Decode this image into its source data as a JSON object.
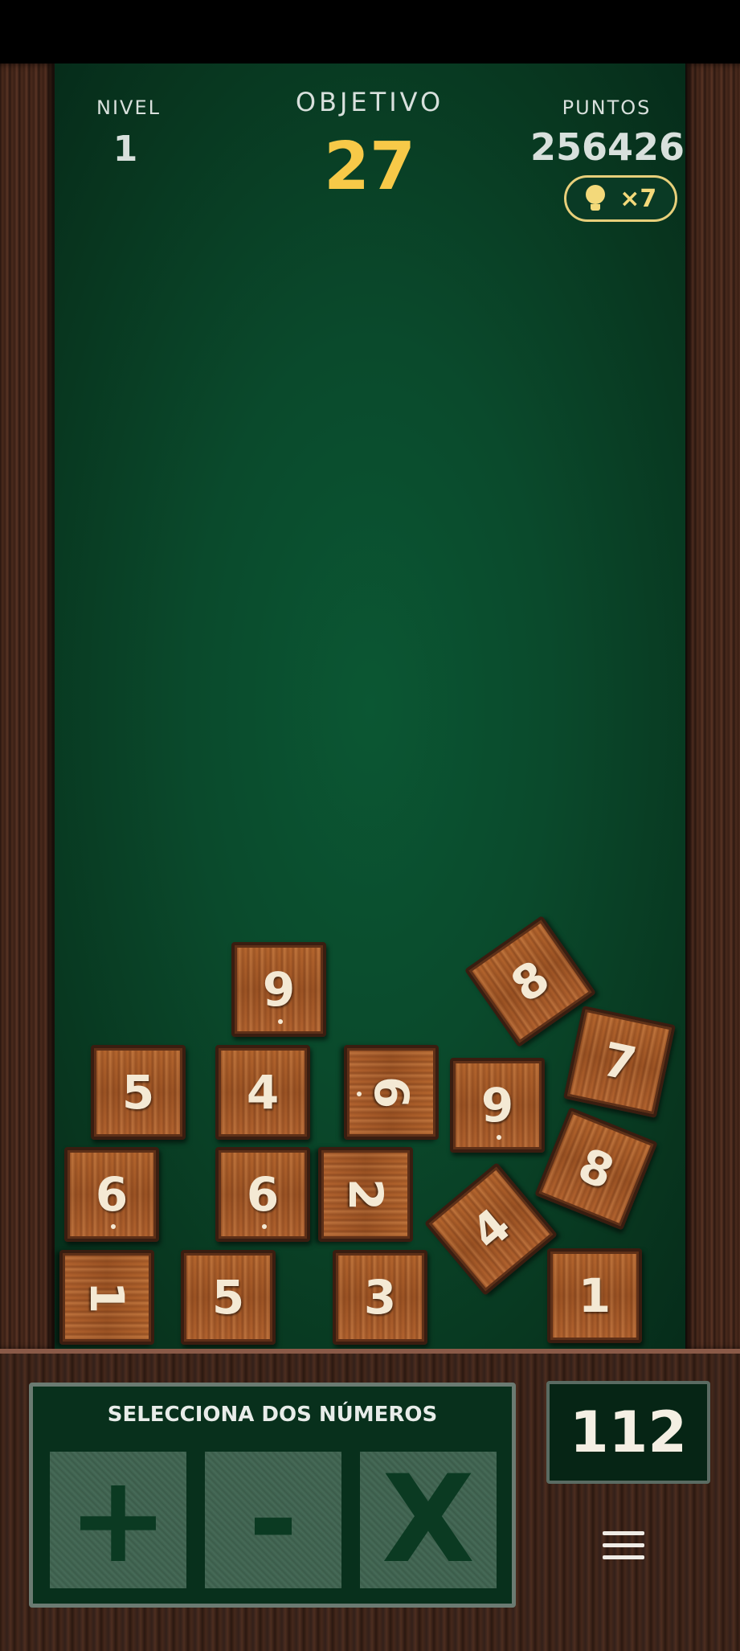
{
  "hud": {
    "level_label": "NIVEL",
    "level_value": "1",
    "goal_label": "OBJETIVO",
    "goal_value": "27",
    "points_label": "PUNTOS",
    "points_value": "256426",
    "hint_icon": "lightbulb-icon",
    "hint_count": "×7"
  },
  "tiles": [
    {
      "value": "9",
      "rotation_deg": 0,
      "underline_dot": true
    },
    {
      "value": "8",
      "rotation_deg": -35,
      "underline_dot": false
    },
    {
      "value": "5",
      "rotation_deg": 0,
      "underline_dot": false
    },
    {
      "value": "4",
      "rotation_deg": 0,
      "underline_dot": false
    },
    {
      "value": "6",
      "rotation_deg": 90,
      "underline_dot": true
    },
    {
      "value": "9",
      "rotation_deg": 0,
      "underline_dot": true
    },
    {
      "value": "7",
      "rotation_deg": 12,
      "underline_dot": false
    },
    {
      "value": "6",
      "rotation_deg": 0,
      "underline_dot": true
    },
    {
      "value": "6",
      "rotation_deg": 0,
      "underline_dot": true
    },
    {
      "value": "2",
      "rotation_deg": 90,
      "underline_dot": false
    },
    {
      "value": "4",
      "rotation_deg": -40,
      "underline_dot": false
    },
    {
      "value": "8",
      "rotation_deg": 22,
      "underline_dot": false
    },
    {
      "value": "1",
      "rotation_deg": 90,
      "underline_dot": false
    },
    {
      "value": "5",
      "rotation_deg": 0,
      "underline_dot": false
    },
    {
      "value": "3",
      "rotation_deg": 0,
      "underline_dot": false
    },
    {
      "value": "1",
      "rotation_deg": 0,
      "underline_dot": false
    }
  ],
  "controls": {
    "instruction": "SELECCIONA DOS NÚMEROS",
    "plus_label": "+",
    "minus_label": "-",
    "times_label": "X",
    "counter_value": "112",
    "menu_icon": "hamburger-menu-icon"
  },
  "colors": {
    "board_green": "#0a4a2c",
    "goal_yellow": "#f7c948",
    "tile_wood": "#a8592a"
  }
}
